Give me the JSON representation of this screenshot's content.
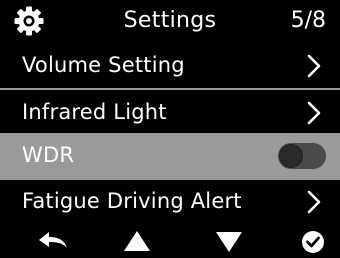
{
  "header": {
    "title": "Settings",
    "page_indicator": "5/8",
    "icon": "gear-icon"
  },
  "menu": {
    "items": [
      {
        "label": "Volume Setting",
        "control": "chevron-right-icon",
        "selected": false
      },
      {
        "label": "Infrared Light",
        "control": "chevron-right-icon",
        "selected": false
      },
      {
        "label": "WDR",
        "control": "toggle",
        "toggle_on": false,
        "selected": true
      },
      {
        "label": "Fatigue Driving Alert",
        "control": "chevron-right-icon",
        "selected": false
      }
    ]
  },
  "footer": {
    "buttons": [
      {
        "icon": "back-arrow-icon"
      },
      {
        "icon": "up-triangle-icon"
      },
      {
        "icon": "down-triangle-icon"
      },
      {
        "icon": "check-circle-icon"
      }
    ]
  },
  "colors": {
    "background": "#000000",
    "text": "#ffffff",
    "selected_row": "#9a9a9a",
    "divider": "#9a9a9a",
    "toggle_track": "#4a4a4a",
    "toggle_knob": "#2a2a2a"
  }
}
